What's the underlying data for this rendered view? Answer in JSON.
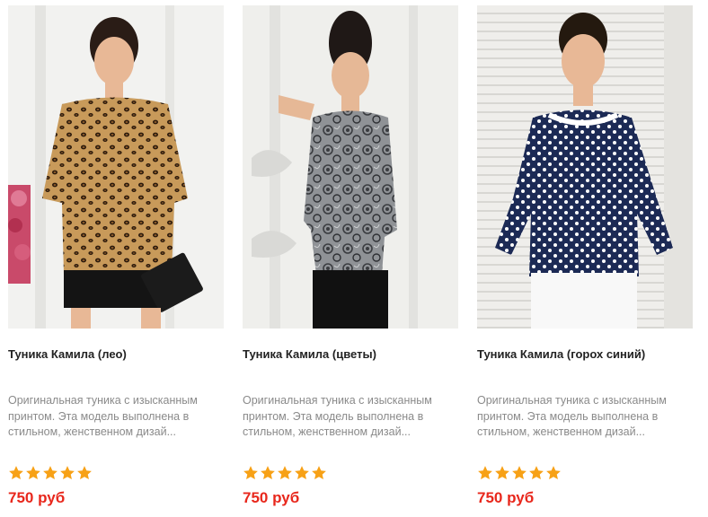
{
  "products": [
    {
      "title": "Туника Камила (лео)",
      "description": "Оригинальная туника с изысканным принтом. Эта модель выполнена в стильном, женственном дизай...",
      "rating": 5,
      "price": "750 руб",
      "image": "model-leopard-tunic"
    },
    {
      "title": "Туника Камила (цветы)",
      "description": "Оригинальная туника с изысканным принтом. Эта модель выполнена в стильном, женственном дизай...",
      "rating": 5,
      "price": "750 руб",
      "image": "model-floral-tunic"
    },
    {
      "title": "Туника Камила (горох синий)",
      "description": "Оригинальная туника с изысканным принтом. Эта модель выполнена в стильном, женственном дизай...",
      "rating": 5,
      "price": "750 руб",
      "image": "model-polka-dot-tunic"
    }
  ],
  "colors": {
    "price": "#e8271c",
    "star": "#f7a116",
    "title": "#222222",
    "description": "#8a8a8a"
  },
  "icons": {
    "rating": "star-icon"
  }
}
